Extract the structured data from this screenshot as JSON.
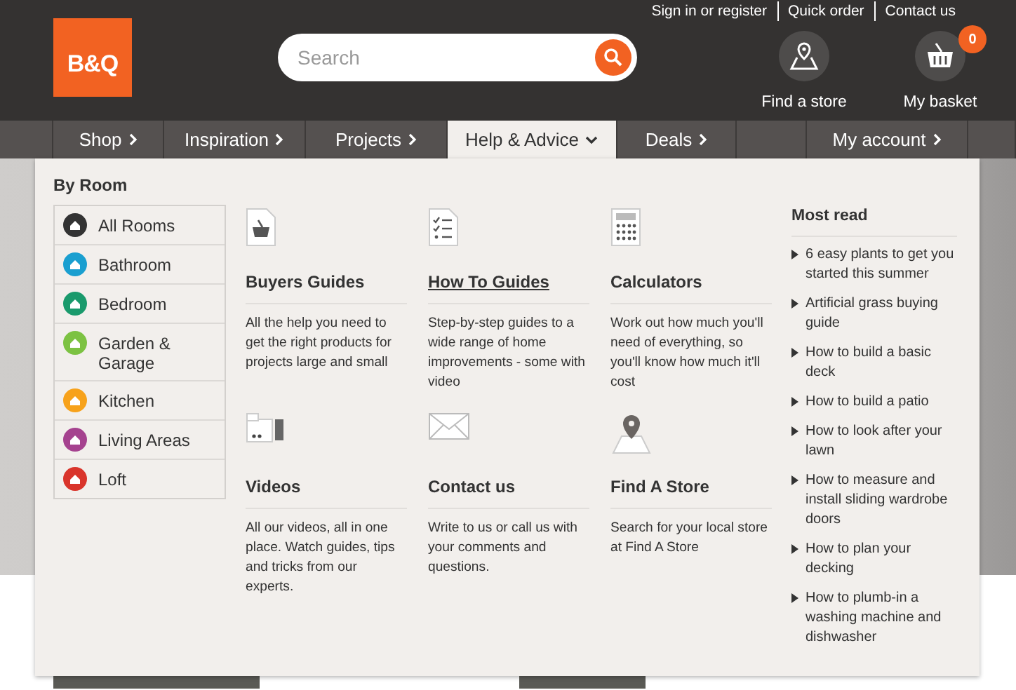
{
  "header": {
    "logo": "B&Q",
    "top_links": [
      "Sign in or register",
      "Quick order",
      "Contact us"
    ],
    "search": {
      "placeholder": "Search"
    },
    "actions": [
      {
        "kind": "store",
        "label": "Find a store"
      },
      {
        "kind": "basket",
        "label": "My basket",
        "badge": "0"
      }
    ]
  },
  "nav": [
    {
      "label": "Shop",
      "selected": false,
      "dropdown": false
    },
    {
      "label": "Inspiration",
      "selected": false,
      "dropdown": false
    },
    {
      "label": "Projects",
      "selected": false,
      "dropdown": false
    },
    {
      "label": "Help & Advice",
      "selected": true,
      "dropdown": true
    },
    {
      "label": "Deals",
      "selected": false,
      "dropdown": false
    },
    {
      "label": "My account",
      "selected": false,
      "dropdown": false
    }
  ],
  "menu": {
    "by_room": {
      "title": "By Room",
      "items": [
        {
          "label": "All Rooms",
          "color": "#333333"
        },
        {
          "label": "Bathroom",
          "color": "#1a9fd0"
        },
        {
          "label": "Bedroom",
          "color": "#1a9a6c"
        },
        {
          "label": "Garden & Garage",
          "color": "#7cc242"
        },
        {
          "label": "Kitchen",
          "color": "#f7a21b"
        },
        {
          "label": "Living Areas",
          "color": "#a5428f"
        },
        {
          "label": "Loft",
          "color": "#d9342b"
        }
      ]
    },
    "guides": [
      {
        "kind": "basket",
        "title": "Buyers Guides",
        "hovered": false,
        "text": "All the help you need to get the right products for projects large and small"
      },
      {
        "kind": "checklist",
        "title": "How To Guides",
        "hovered": true,
        "text": "Step-by-step guides to a wide range of home improvements - some with video"
      },
      {
        "kind": "calculator",
        "title": "Calculators",
        "hovered": false,
        "text": "Work out how much you'll need of everything, so you'll know how much it'll cost"
      },
      {
        "kind": "video",
        "title": "Videos",
        "hovered": false,
        "text": "All our videos, all in one place. Watch guides, tips and tricks from our experts."
      },
      {
        "kind": "envelope",
        "title": "Contact us",
        "hovered": false,
        "text": "Write to us or call us with your comments and questions."
      },
      {
        "kind": "pin",
        "title": "Find A Store",
        "hovered": false,
        "text": "Search for your local store at Find A Store"
      }
    ],
    "most_read": {
      "title": "Most read",
      "items": [
        "6 easy plants to get you started this summer",
        "Artificial grass buying guide",
        "How to build a basic deck",
        "How to build a patio",
        "How to look after your lawn",
        "How to measure and install sliding wardrobe doors",
        "How to plan your decking",
        "How to plumb-in a washing machine and dishwasher"
      ]
    }
  }
}
